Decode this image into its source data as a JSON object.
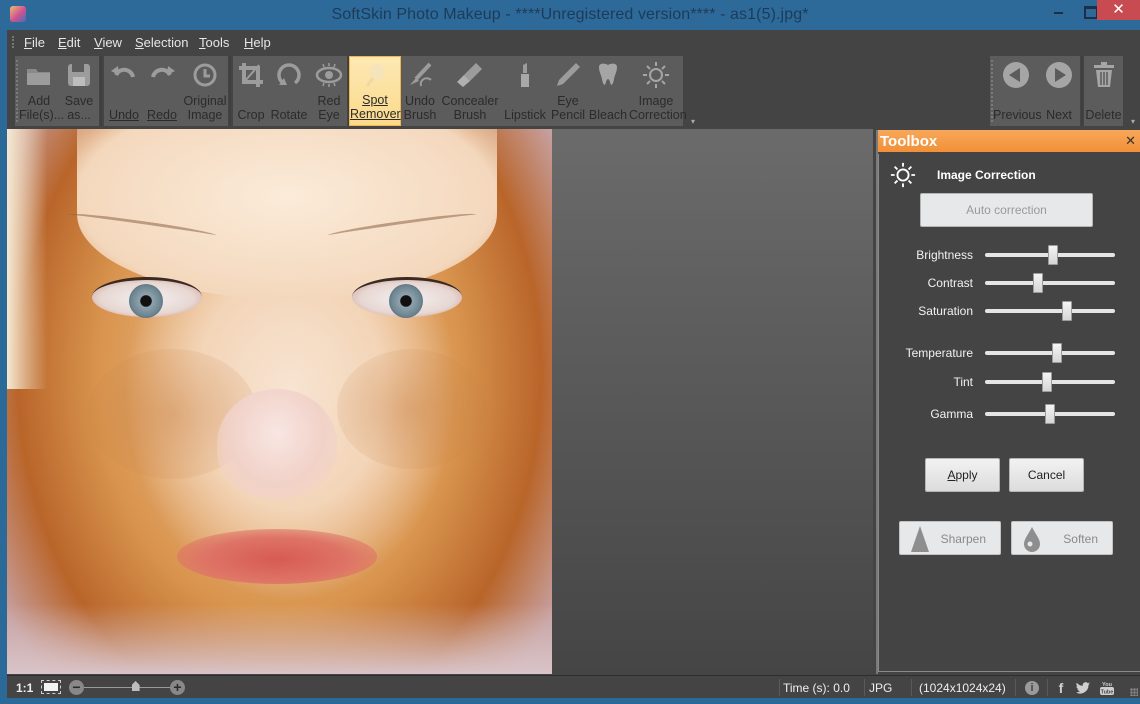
{
  "window": {
    "title": "SoftSkin Photo Makeup - ****Unregistered version**** - as1(5).jpg*",
    "minimize_label": "",
    "maximize_label": "",
    "close_label": "✕"
  },
  "menu": {
    "items": [
      {
        "label": "File",
        "mnemonic": "F"
      },
      {
        "label": "Edit",
        "mnemonic": "E"
      },
      {
        "label": "View",
        "mnemonic": "V"
      },
      {
        "label": "Selection",
        "mnemonic": "S"
      },
      {
        "label": "Tools",
        "mnemonic": "T"
      },
      {
        "label": "Help",
        "mnemonic": "H"
      }
    ]
  },
  "toolbar": {
    "add_files": {
      "line1": "Add",
      "line2": "File(s)...",
      "icon": "folder-open-icon"
    },
    "save_as": {
      "line1": "Save",
      "line2": "as...",
      "icon": "floppy-disk-icon"
    },
    "undo": {
      "label": "Undo",
      "icon": "undo-arrow-icon"
    },
    "redo": {
      "label": "Redo",
      "icon": "redo-arrow-icon"
    },
    "original_image": {
      "line1": "Original",
      "line2": "Image",
      "icon": "history-clock-icon"
    },
    "crop": {
      "label": "Crop",
      "icon": "crop-icon"
    },
    "rotate": {
      "label": "Rotate",
      "icon": "rotate-icon"
    },
    "red_eye": {
      "line1": "Red",
      "line2": "Eye",
      "icon": "eye-icon"
    },
    "spot_remover": {
      "line1": "Spot",
      "line2": "Remover",
      "icon": "cotton-swab-icon",
      "active": true
    },
    "undo_brush": {
      "line1": "Undo",
      "line2": "Brush",
      "icon": "undo-brush-icon"
    },
    "concealer_brush": {
      "line1": "Concealer",
      "line2": "Brush",
      "icon": "concealer-brush-icon"
    },
    "lipstick": {
      "label": "Lipstick",
      "icon": "lipstick-icon"
    },
    "eye_pencil": {
      "line1": "Eye",
      "line2": "Pencil",
      "icon": "pencil-icon"
    },
    "bleach": {
      "label": "Bleach",
      "icon": "tooth-icon"
    },
    "image_correction": {
      "line1": "Image",
      "line2": "Correction",
      "icon": "sun-icon"
    },
    "previous": {
      "label": "Previous",
      "icon": "arrow-left-circle-icon"
    },
    "next": {
      "label": "Next",
      "icon": "arrow-right-circle-icon"
    },
    "delete": {
      "label": "Delete",
      "icon": "trash-icon"
    }
  },
  "toolbox": {
    "title": "Toolbox",
    "close_label": "✕",
    "section_title": "Image Correction",
    "auto_correction_label": "Auto correction",
    "sliders": [
      {
        "label": "Brightness",
        "value": 0.52
      },
      {
        "label": "Contrast",
        "value": 0.41
      },
      {
        "label": "Saturation",
        "value": 0.63
      },
      {
        "label": "Temperature",
        "value": 0.55
      },
      {
        "label": "Tint",
        "value": 0.48
      },
      {
        "label": "Gamma",
        "value": 0.5
      }
    ],
    "apply_label": "Apply",
    "apply_mnemonic": "A",
    "cancel_label": "Cancel",
    "sharpen_label": "Sharpen",
    "soften_label": "Soften"
  },
  "statusbar": {
    "zoom_label": "1:1",
    "zoom_level": 0.6,
    "time": "Time (s): 0.0",
    "format": "JPG",
    "dimensions": "(1024x1024x24)",
    "info_icon": "i",
    "facebook_icon": "f",
    "twitter_icon": "t",
    "youtube_icon": "You Tube"
  },
  "colors": {
    "titlebar": "#2d6a9a",
    "app_bg": "#444444",
    "toolbox_header": "#f28f37",
    "active_tool": "#fbd98b",
    "close_button": "#c74b50"
  }
}
